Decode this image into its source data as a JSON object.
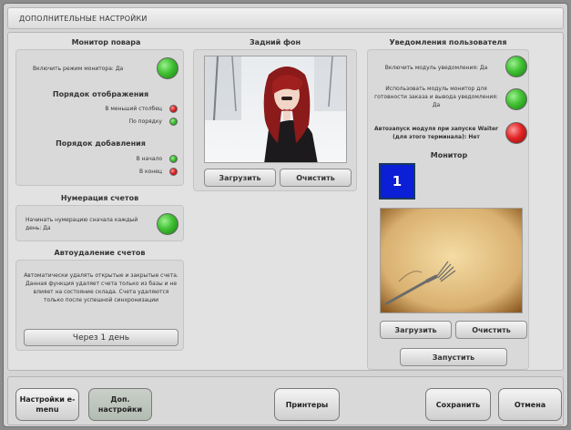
{
  "window": {
    "title": "ДОПОЛНИТЕЛЬНЫЕ НАСТРОЙКИ"
  },
  "chef_monitor": {
    "heading": "Монитор повара",
    "enable_label": "Включить режим монитора: Да",
    "enable_state": "green",
    "display_order_heading": "Порядок отображения",
    "display_options": [
      {
        "label": "В меньший столбец",
        "state": "red"
      },
      {
        "label": "По порядку",
        "state": "green"
      }
    ],
    "add_order_heading": "Порядок добавления",
    "add_options": [
      {
        "label": "В начало",
        "state": "green"
      },
      {
        "label": "В конец",
        "state": "red"
      }
    ]
  },
  "bill_numbering": {
    "heading": "Нумерация счетов",
    "label": "Начинать нумерацию сначала каждый день: Да",
    "state": "green"
  },
  "auto_delete": {
    "heading": "Автоудаление счетов",
    "description": "Автоматически удалять открытые и закрытые счета. Данная функция удаляет счета только из базы и не влияет на состояние склада. Счета удаляются только после успешной синхронизации",
    "period_value": "Через 1 день"
  },
  "background": {
    "heading": "Задний фон",
    "upload_label": "Загрузить",
    "clear_label": "Очистить"
  },
  "user_notifications": {
    "heading": "Уведомления пользователя",
    "options": [
      {
        "label": "Включить модуль уведомления: Да",
        "state": "green"
      },
      {
        "label": "Использовать модуль монитор для готовности заказа и вывода уведомления: Да",
        "state": "green"
      },
      {
        "label": "Автозапуск модуля при запуске Waiter (для этого терминала): Нет",
        "state": "red"
      }
    ],
    "monitor_heading": "Монитор",
    "monitor_number": "1",
    "upload_label": "Загрузить",
    "clear_label": "Очистить",
    "launch_label": "Запустить"
  },
  "bottom_bar": {
    "emenu_settings": "Настройки e-menu",
    "extra_settings": "Доп. настройки",
    "printers": "Принтеры",
    "save": "Сохранить",
    "cancel": "Отмена"
  },
  "colors": {
    "led_green": "#3fc032",
    "led_red": "#e22424",
    "monitor_blue": "#0a1fd6"
  }
}
